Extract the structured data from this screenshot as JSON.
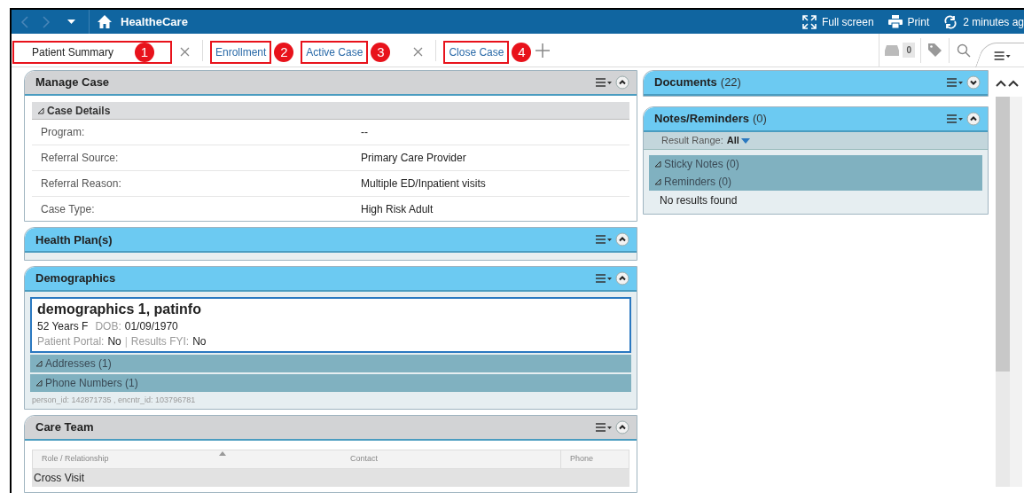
{
  "topbar": {
    "title": "HealtheCare",
    "actions": [
      {
        "label": "Full screen",
        "kind": "fullscreen"
      },
      {
        "label": "Print",
        "kind": "print"
      },
      {
        "label": "2 minutes ag",
        "kind": "refresh"
      }
    ]
  },
  "tabs": [
    {
      "label": "Patient Summary",
      "selected": true,
      "closable": true,
      "callout": "1"
    },
    {
      "label": "Enrollment",
      "selected": false,
      "closable": false,
      "callout": "2"
    },
    {
      "label": "Active Case",
      "selected": false,
      "closable": true,
      "callout": "3"
    },
    {
      "label": "Close Case",
      "selected": false,
      "closable": false,
      "callout": "4"
    }
  ],
  "toolbar": {
    "inbox_count": "0"
  },
  "left_panels": [
    {
      "kind": "details",
      "title": "Manage Case",
      "color": "#d2d3d5",
      "expanded": true,
      "section": "Case Details",
      "rows": [
        {
          "label": "Program:",
          "value": "--"
        },
        {
          "label": "Referral Source:",
          "value": "Primary Care Provider"
        },
        {
          "label": "Referral Reason:",
          "value": "Multiple ED/Inpatient visits"
        },
        {
          "label": "Case Type:",
          "value": "High Risk Adult"
        }
      ]
    },
    {
      "kind": "empty",
      "title": "Health Plan(s)",
      "color": "#6ccaf2",
      "expanded": true
    },
    {
      "kind": "demographics",
      "title": "Demographics",
      "color": "#6ccaf2",
      "expanded": true,
      "name": "demographics 1, patinfo",
      "age_sex": "52 Years F",
      "dob_label": "DOB:",
      "dob": "01/09/1970",
      "portal_label": "Patient Portal:",
      "portal": "No",
      "separator": "|",
      "fyi_label": "Results FYI:",
      "fyi": "No",
      "sections": [
        "Addresses (1)",
        "Phone Numbers (1)"
      ],
      "footer": "person_id: 142871735 , encntr_id: 103796781"
    },
    {
      "kind": "table",
      "title": "Care Team",
      "color": "#d2d3d5",
      "expanded": true,
      "columns": [
        "Role / Relationship",
        "Contact",
        "Phone"
      ],
      "group": "Cross Visit"
    }
  ],
  "right_panels": [
    {
      "kind": "empty",
      "title": "Documents",
      "count": "(22)",
      "color": "#6ccaf2",
      "expanded": false
    },
    {
      "kind": "notes",
      "title": "Notes/Reminders",
      "count": "(0)",
      "color": "#6ccaf2",
      "expanded": true,
      "range_label": "Result Range:",
      "range_value": "All",
      "sections": [
        "Sticky Notes (0)",
        "Reminders (0)"
      ],
      "empty": "No results found"
    }
  ]
}
